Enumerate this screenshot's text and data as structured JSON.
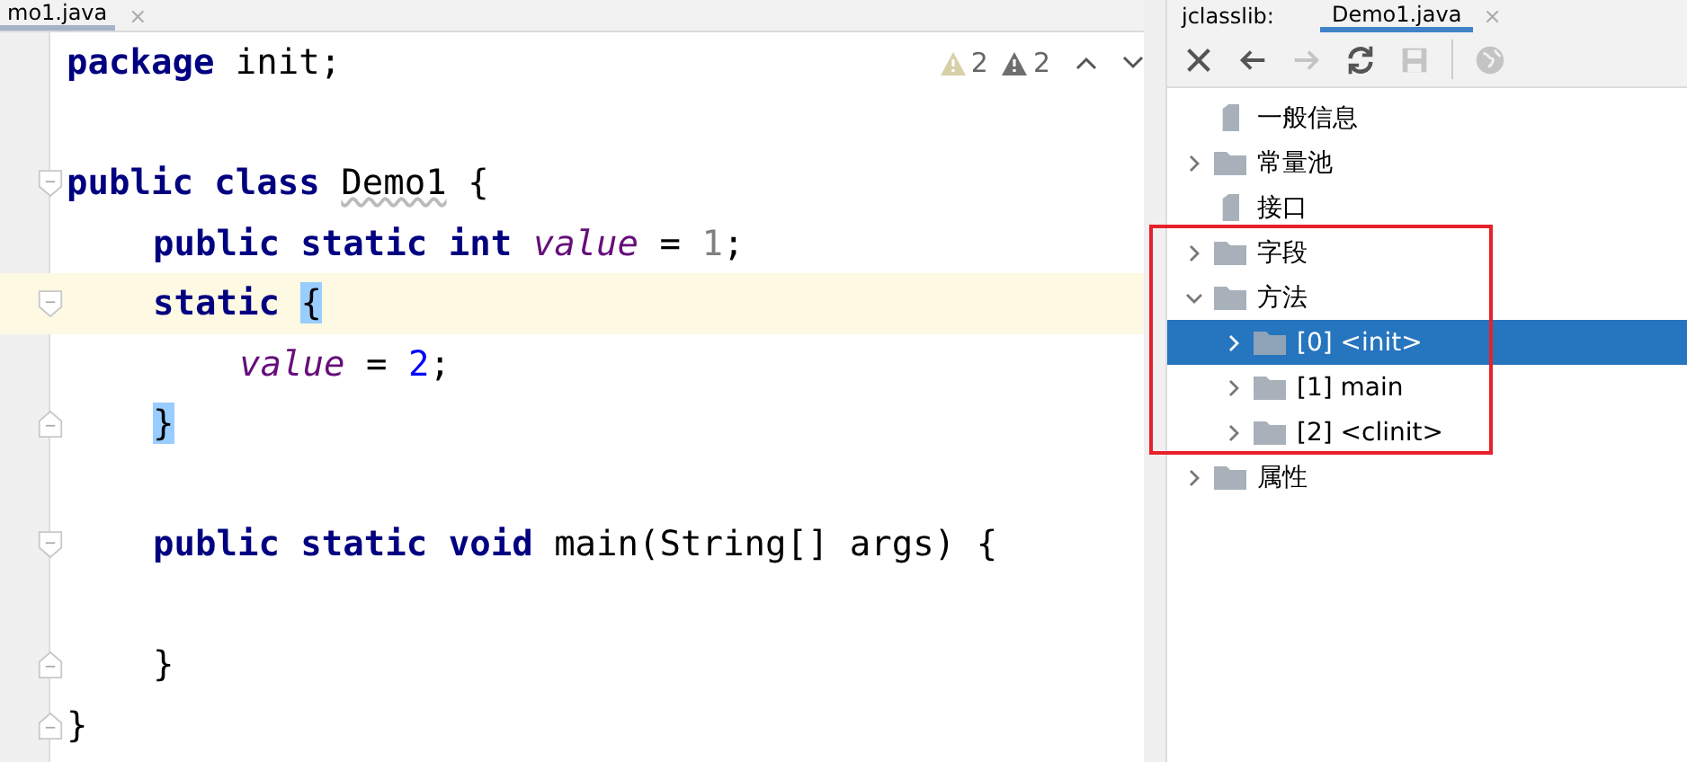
{
  "editor": {
    "tab": {
      "label": "mo1.java",
      "close": "×"
    },
    "inspections": [
      {
        "kind": "weak-warning",
        "count": "2"
      },
      {
        "kind": "warning",
        "count": "2"
      }
    ],
    "lines": [
      {
        "kind": "code",
        "fold_start": false,
        "fold_end": false,
        "current": false,
        "tokens": [
          {
            "t": "package",
            "kind": "keyword"
          },
          {
            "t": " init;",
            "kind": "plain"
          }
        ]
      },
      {
        "kind": "blank",
        "fold_start": false,
        "fold_end": false,
        "current": false
      },
      {
        "kind": "code",
        "fold_start": true,
        "fold_end": false,
        "current": false,
        "tokens": [
          {
            "t": "public class ",
            "kind": "keyword"
          },
          {
            "t": "Demo1",
            "kind": "warn"
          },
          {
            "t": " {",
            "kind": "plain"
          }
        ],
        "children": [
          {
            "kind": "code",
            "fold_start": false,
            "fold_end": false,
            "current": false,
            "tokens": [
              {
                "t": "public static int ",
                "kind": "keyword"
              },
              {
                "t": "value",
                "kind": "field"
              },
              {
                "t": " = ",
                "kind": "plain"
              },
              {
                "t": "1",
                "kind": "dim"
              },
              {
                "t": ";",
                "kind": "plain"
              }
            ]
          },
          {
            "kind": "code",
            "fold_start": true,
            "fold_end": false,
            "current": true,
            "tokens": [
              {
                "t": "static ",
                "kind": "keyword"
              },
              {
                "t": "{",
                "kind": "brace-match"
              }
            ],
            "children": [
              {
                "kind": "code",
                "fold_start": false,
                "fold_end": false,
                "current": false,
                "tokens": [
                  {
                    "t": "value",
                    "kind": "field"
                  },
                  {
                    "t": " = ",
                    "kind": "plain"
                  },
                  {
                    "t": "2",
                    "kind": "number"
                  },
                  {
                    "t": ";",
                    "kind": "plain"
                  }
                ]
              }
            ]
          },
          {
            "kind": "code",
            "fold_start": false,
            "fold_end": true,
            "current": false,
            "tokens": [
              {
                "t": "}",
                "kind": "brace-match"
              }
            ]
          },
          {
            "kind": "blank",
            "fold_start": false,
            "fold_end": false,
            "current": false
          },
          {
            "kind": "code",
            "fold_start": true,
            "fold_end": false,
            "current": false,
            "tokens": [
              {
                "t": "public static void",
                "kind": "keyword"
              },
              {
                "t": " main(String[] args) {",
                "kind": "plain"
              }
            ],
            "children": [
              {
                "kind": "blank",
                "fold_start": false,
                "fold_end": false,
                "current": false
              }
            ]
          },
          {
            "kind": "code",
            "fold_start": false,
            "fold_end": true,
            "current": false,
            "tokens": [
              {
                "t": "}",
                "kind": "plain"
              }
            ]
          }
        ]
      },
      {
        "kind": "code",
        "fold_start": false,
        "fold_end": true,
        "current": false,
        "tokens": [
          {
            "t": "}",
            "kind": "plain"
          }
        ]
      }
    ]
  },
  "panel": {
    "tabs": [
      {
        "label": "jclasslib:",
        "selected": false
      },
      {
        "label": "Demo1.java",
        "selected": true,
        "close": "×"
      }
    ],
    "toolbar": [
      {
        "kind": "close",
        "disabled": false
      },
      {
        "kind": "back",
        "disabled": false
      },
      {
        "kind": "forward",
        "disabled": true
      },
      {
        "kind": "refresh",
        "disabled": false
      },
      {
        "kind": "save",
        "disabled": true
      },
      {
        "kind": "web",
        "disabled": true
      }
    ],
    "tree": [
      {
        "label": "一般信息",
        "kind": "file",
        "selected": false
      },
      {
        "label": "常量池",
        "kind": "folder",
        "expanded": false,
        "selected": false
      },
      {
        "label": "接口",
        "kind": "file",
        "selected": false
      },
      {
        "label": "字段",
        "kind": "folder",
        "expanded": false,
        "selected": false
      },
      {
        "label": "方法",
        "kind": "folder",
        "expanded": true,
        "selected": false,
        "children": [
          {
            "label": "[0] <init>",
            "kind": "folder",
            "expanded": false,
            "selected": true
          },
          {
            "label": "[1] main",
            "kind": "folder",
            "expanded": false,
            "selected": false
          },
          {
            "label": "[2] <clinit>",
            "kind": "folder",
            "expanded": false,
            "selected": false
          }
        ]
      },
      {
        "label": "属性",
        "kind": "folder",
        "expanded": false,
        "selected": false
      }
    ]
  }
}
